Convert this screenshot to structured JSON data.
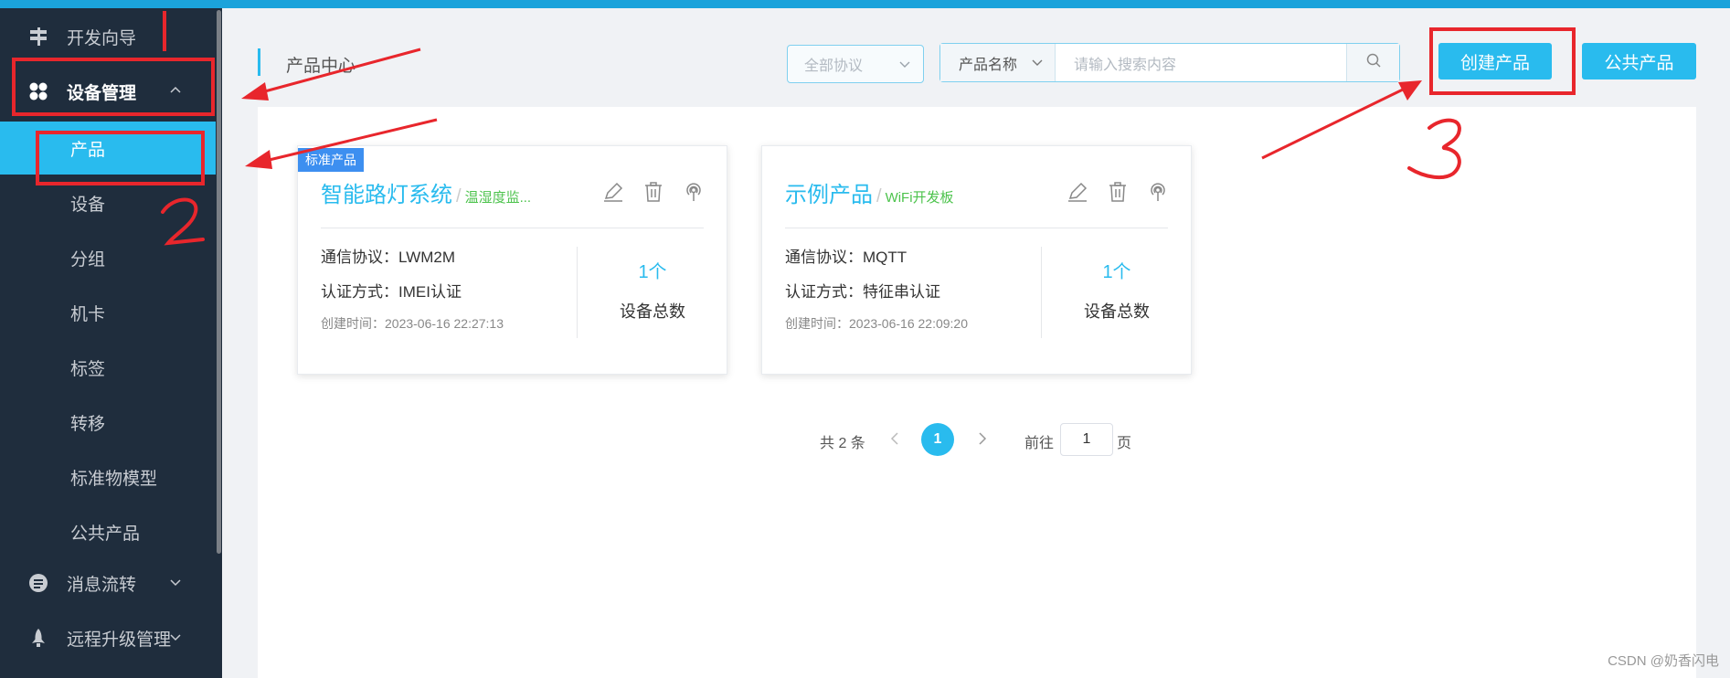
{
  "sidebar": {
    "items": [
      {
        "label": "开发向导",
        "icon": "signpost-icon"
      },
      {
        "label": "设备管理",
        "icon": "grid-icon",
        "expanded": true
      },
      {
        "label": "消息流转",
        "icon": "message-icon"
      },
      {
        "label": "远程升级管理",
        "icon": "rocket-icon"
      }
    ],
    "sub_items": [
      "产品",
      "设备",
      "分组",
      "机卡",
      "标签",
      "转移",
      "标准物模型",
      "公共产品"
    ],
    "active_sub_item": "产品"
  },
  "header": {
    "title": "产品中心",
    "protocol_select": "全部协议",
    "search_field": "产品名称",
    "search_placeholder": "请输入搜索内容",
    "create_button": "创建产品",
    "public_button": "公共产品"
  },
  "cards": [
    {
      "tag": "标准产品",
      "name": "智能路灯系统",
      "subtitle": "温湿度监...",
      "protocol": "通信协议：LWM2M",
      "auth": "认证方式：IMEI认证",
      "created": "创建时间：2023-06-16 22:27:13",
      "count": "1个",
      "count_label": "设备总数"
    },
    {
      "name": "示例产品",
      "subtitle": "WiFi开发板",
      "protocol": "通信协议：MQTT",
      "auth": "认证方式：特征串认证",
      "created": "创建时间：2023-06-16 22:09:20",
      "count": "1个",
      "count_label": "设备总数"
    }
  ],
  "pagination": {
    "total": "共 2 条",
    "current_page": "1",
    "goto_label": "前往",
    "goto_value": "1",
    "goto_suffix": "页"
  },
  "watermark": "CSDN @奶香闪电",
  "colors": {
    "accent": "#29bbee",
    "sidebar": "#1f2d3d",
    "annotation": "#e8262c",
    "tag": "#3d8ff0",
    "subtitle_green": "#4cc34c"
  }
}
